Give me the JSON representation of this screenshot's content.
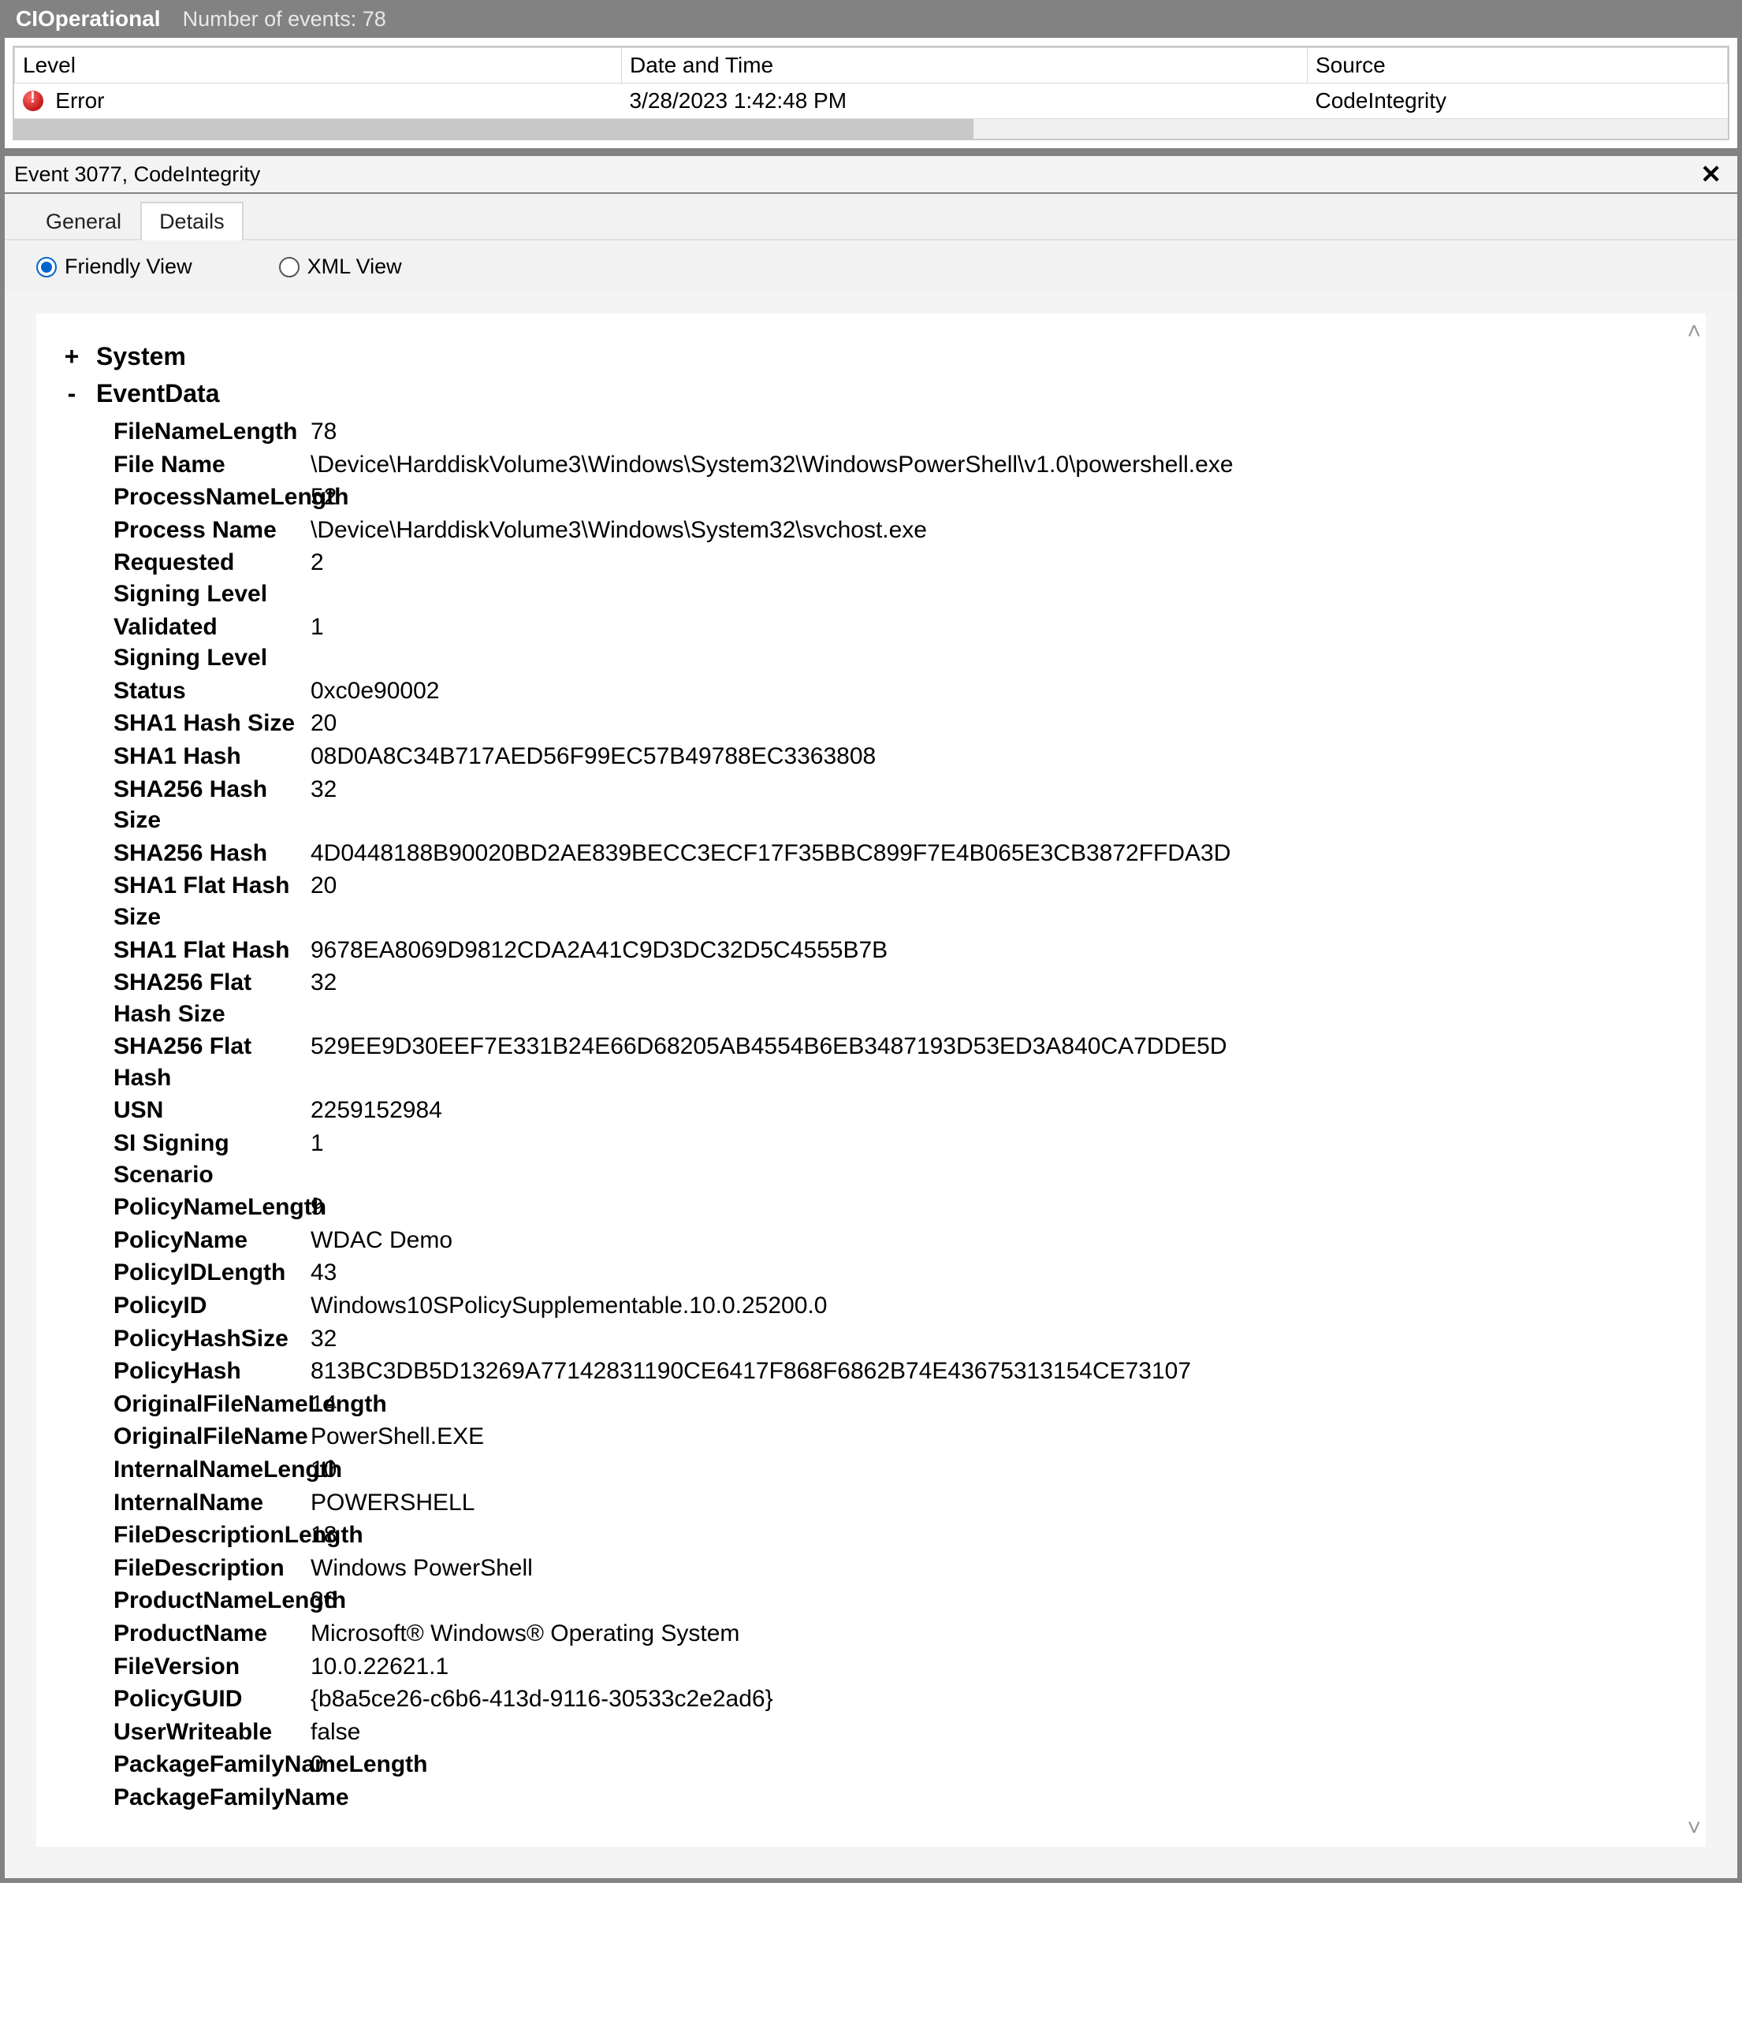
{
  "titlebar": {
    "title": "CIOperational",
    "count_text": "Number of events: 78"
  },
  "table": {
    "headers": {
      "level": "Level",
      "datetime": "Date and Time",
      "source": "Source"
    },
    "row": {
      "level": "Error",
      "datetime": "3/28/2023 1:42:48 PM",
      "source": "CodeIntegrity"
    }
  },
  "details": {
    "header_text": "Event 3077, CodeIntegrity",
    "tabs": {
      "general": "General",
      "details": "Details"
    },
    "viewmode": {
      "friendly": "Friendly View",
      "xml": "XML View"
    },
    "nodes": {
      "system": "System",
      "eventdata": "EventData"
    },
    "expanders": {
      "plus": "+",
      "minus": "-"
    },
    "close_glyph": "✕"
  },
  "eventdata": [
    {
      "k": "FileNameLength",
      "v": "78"
    },
    {
      "k": "File Name",
      "v": "\\Device\\HarddiskVolume3\\Windows\\System32\\WindowsPowerShell\\v1.0\\powershell.exe"
    },
    {
      "k": "ProcessNameLength",
      "v": "52"
    },
    {
      "k": "Process Name",
      "v": "\\Device\\HarddiskVolume3\\Windows\\System32\\svchost.exe"
    },
    {
      "k": "Requested Signing Level",
      "v": "2"
    },
    {
      "k": "Validated Signing Level",
      "v": "1"
    },
    {
      "k": "Status",
      "v": "0xc0e90002"
    },
    {
      "k": "SHA1 Hash Size",
      "v": "20"
    },
    {
      "k": "SHA1 Hash",
      "v": "08D0A8C34B717AED56F99EC57B49788EC3363808"
    },
    {
      "k": "SHA256 Hash Size",
      "v": "32"
    },
    {
      "k": "SHA256 Hash",
      "v": "4D0448188B90020BD2AE839BECC3ECF17F35BBC899F7E4B065E3CB3872FFDA3D"
    },
    {
      "k": "SHA1 Flat Hash Size",
      "v": "20"
    },
    {
      "k": "SHA1 Flat Hash",
      "v": "9678EA8069D9812CDA2A41C9D3DC32D5C4555B7B"
    },
    {
      "k": "SHA256 Flat Hash Size",
      "v": "32"
    },
    {
      "k": "SHA256 Flat Hash",
      "v": "529EE9D30EEF7E331B24E66D68205AB4554B6EB3487193D53ED3A840CA7DDE5D"
    },
    {
      "k": "USN",
      "v": "2259152984"
    },
    {
      "k": "SI Signing Scenario",
      "v": "1"
    },
    {
      "k": "PolicyNameLength",
      "v": "9"
    },
    {
      "k": "PolicyName",
      "v": "WDAC Demo"
    },
    {
      "k": "PolicyIDLength",
      "v": "43"
    },
    {
      "k": "PolicyID",
      "v": "Windows10SPolicySupplementable.10.0.25200.0"
    },
    {
      "k": "PolicyHashSize",
      "v": "32"
    },
    {
      "k": "PolicyHash",
      "v": "813BC3DB5D13269A77142831190CE6417F868F6862B74E43675313154CE73107"
    },
    {
      "k": "OriginalFileNameLength",
      "v": "14"
    },
    {
      "k": "OriginalFileName",
      "v": "PowerShell.EXE"
    },
    {
      "k": "InternalNameLength",
      "v": "10"
    },
    {
      "k": "InternalName",
      "v": "POWERSHELL"
    },
    {
      "k": "FileDescriptionLength",
      "v": "18"
    },
    {
      "k": "FileDescription",
      "v": "Windows PowerShell"
    },
    {
      "k": "ProductNameLength",
      "v": "36"
    },
    {
      "k": "ProductName",
      "v": "Microsoft® Windows® Operating System"
    },
    {
      "k": "FileVersion",
      "v": "10.0.22621.1"
    },
    {
      "k": "PolicyGUID",
      "v": "{b8a5ce26-c6b6-413d-9116-30533c2e2ad6}"
    },
    {
      "k": "UserWriteable",
      "v": "false"
    },
    {
      "k": "PackageFamilyNameLength",
      "v": "0"
    },
    {
      "k": "PackageFamilyName",
      "v": ""
    }
  ]
}
